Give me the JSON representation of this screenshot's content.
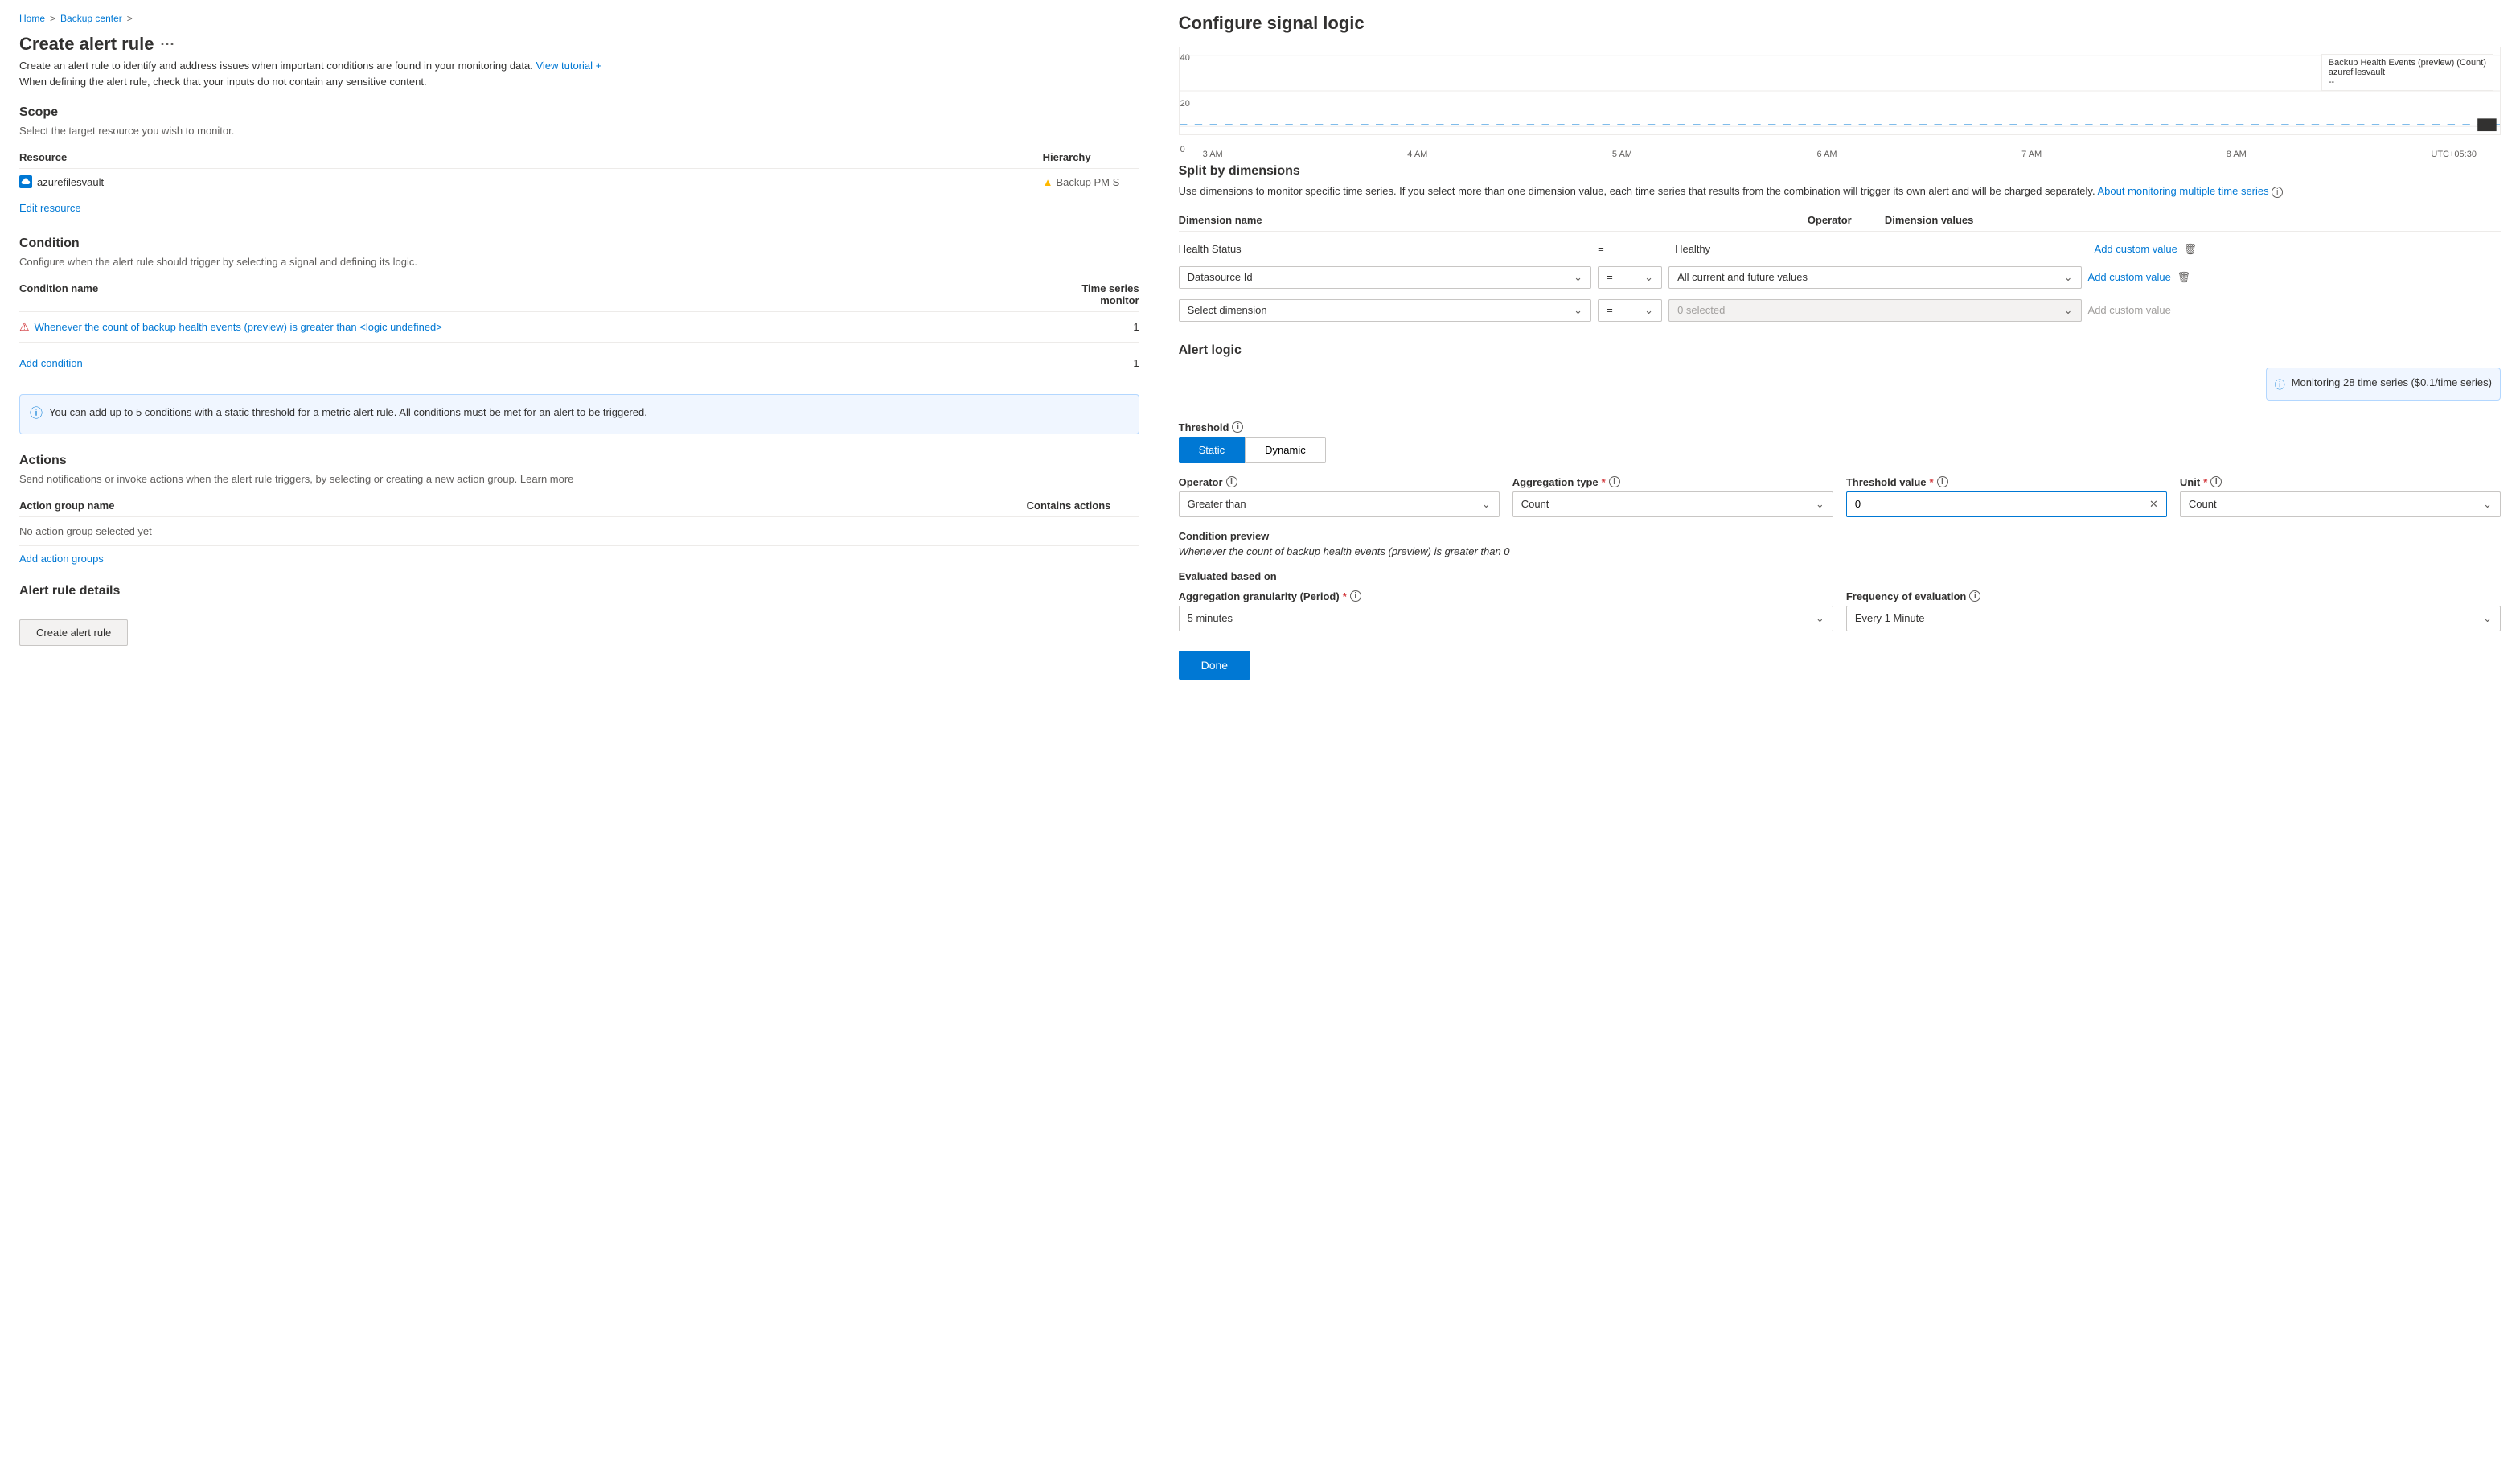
{
  "breadcrumb": {
    "home": "Home",
    "separator1": ">",
    "backup_center": "Backup center",
    "separator2": ">"
  },
  "left": {
    "page_title": "Create alert rule",
    "more_icon": "···",
    "description": "Create an alert rule to identify and address issues when important conditions are found in your monitoring data.",
    "view_tutorial_link": "View tutorial +",
    "description2": "When defining the alert rule, check that your inputs do not contain any sensitive content.",
    "scope": {
      "title": "Scope",
      "desc": "Select the target resource you wish to monitor.",
      "table_headers": [
        "Resource",
        "Hierarchy"
      ],
      "resource_name": "azurefilesvault",
      "hierarchy": "Backup PM S",
      "edit_link": "Edit resource"
    },
    "condition": {
      "title": "Condition",
      "desc": "Configure when the alert rule should trigger by selecting a signal and defining its logic.",
      "table_headers": [
        "Condition name",
        "Time series monitor"
      ],
      "condition_link": "Whenever the count of backup health events (preview) is greater than <logic undefined>",
      "condition_time_series": "1",
      "add_condition": "Add condition",
      "add_condition_time_series": "1",
      "info_text": "You can add up to 5 conditions with a static threshold for a metric alert rule. All conditions must be met for an alert to be triggered."
    },
    "actions": {
      "title": "Actions",
      "desc": "Send notifications or invoke actions when the alert rule triggers, by selecting or creating a new action group.",
      "learn_more_link": "Learn more",
      "table_headers": [
        "Action group name",
        "Contains actions"
      ],
      "no_action": "No action group selected yet",
      "add_action_link": "Add action groups"
    },
    "alert_details": {
      "title": "Alert rule details"
    },
    "create_btn": "Create alert rule"
  },
  "right": {
    "title": "Configure signal logic",
    "chart": {
      "y_labels": [
        "40",
        "20",
        "0"
      ],
      "x_labels": [
        "3 AM",
        "4 AM",
        "5 AM",
        "6 AM",
        "7 AM",
        "8 AM",
        "UTC+05:30"
      ],
      "legend_title": "Backup Health Events (preview) (Count)",
      "legend_sub": "azurefilesvault",
      "legend_value": "--"
    },
    "split_by_dimensions": {
      "title": "Split by dimensions",
      "desc": "Use dimensions to monitor specific time series. If you select more than one dimension value, each time series that results from the combination will trigger its own alert and will be charged separately.",
      "link": "About monitoring multiple time series",
      "table_headers": [
        "Dimension name",
        "Operator",
        "Dimension values"
      ],
      "rows": [
        {
          "name": "Health Status",
          "operator": "=",
          "values": "Healthy",
          "custom_link": "Add custom value",
          "has_delete": true
        },
        {
          "name": "Datasource Id",
          "operator": "=",
          "values": "All current and future values",
          "custom_link": "Add custom value",
          "has_delete": true
        },
        {
          "name": "Select dimension",
          "operator": "=",
          "values": "0 selected",
          "custom_link": "Add custom value",
          "has_delete": false
        }
      ]
    },
    "alert_logic": {
      "title": "Alert logic",
      "threshold_label": "Threshold",
      "threshold_info": "i",
      "static_btn": "Static",
      "dynamic_btn": "Dynamic",
      "operator_label": "Operator",
      "operator_info": "i",
      "operator_value": "Greater than",
      "aggregation_label": "Aggregation type",
      "aggregation_required": "*",
      "aggregation_info": "i",
      "aggregation_value": "Count",
      "threshold_value_label": "Threshold value",
      "threshold_value_required": "*",
      "threshold_value_info": "i",
      "threshold_value": "0",
      "unit_label": "Unit",
      "unit_required": "*",
      "unit_info": "i",
      "unit_value": "Count",
      "monitoring_info": "Monitoring 28 time series ($0.1/time series)",
      "condition_preview": {
        "title": "Condition preview",
        "text": "Whenever the count of backup health events (preview) is greater than 0"
      },
      "evaluated_based_on": {
        "title": "Evaluated based on",
        "agg_granularity_label": "Aggregation granularity (Period)",
        "agg_granularity_required": "*",
        "agg_granularity_info": "i",
        "agg_granularity_value": "5 minutes",
        "frequency_label": "Frequency of evaluation",
        "frequency_info": "i",
        "frequency_value": "Every 1 Minute"
      }
    },
    "done_btn": "Done"
  }
}
